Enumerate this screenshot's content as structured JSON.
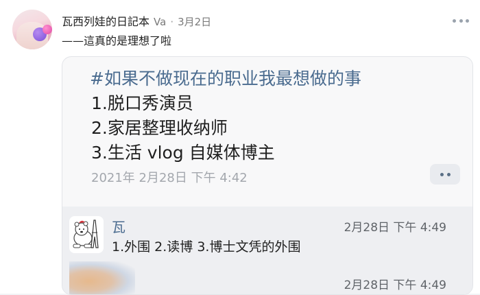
{
  "post": {
    "user_name": "瓦西列娃的日記本",
    "user_handle": "Va",
    "separator": "·",
    "date": "3月2日",
    "text": "——這真的是理想了啦"
  },
  "quote": {
    "title": "#如果不做现在的职业我最想做的事",
    "lines": [
      "1.脱口秀演员",
      "2.家居整理收纳师",
      "3.生活 vlog 自媒体博主"
    ],
    "date": "2021年 2月28日 下午 4:42"
  },
  "comments": [
    {
      "name": "瓦",
      "time": "2月28日 下午 4:49",
      "text": "1.外围 2.读博 3.博士文凭的外围"
    },
    {
      "time": "2月28日 下午 4:49"
    }
  ]
}
